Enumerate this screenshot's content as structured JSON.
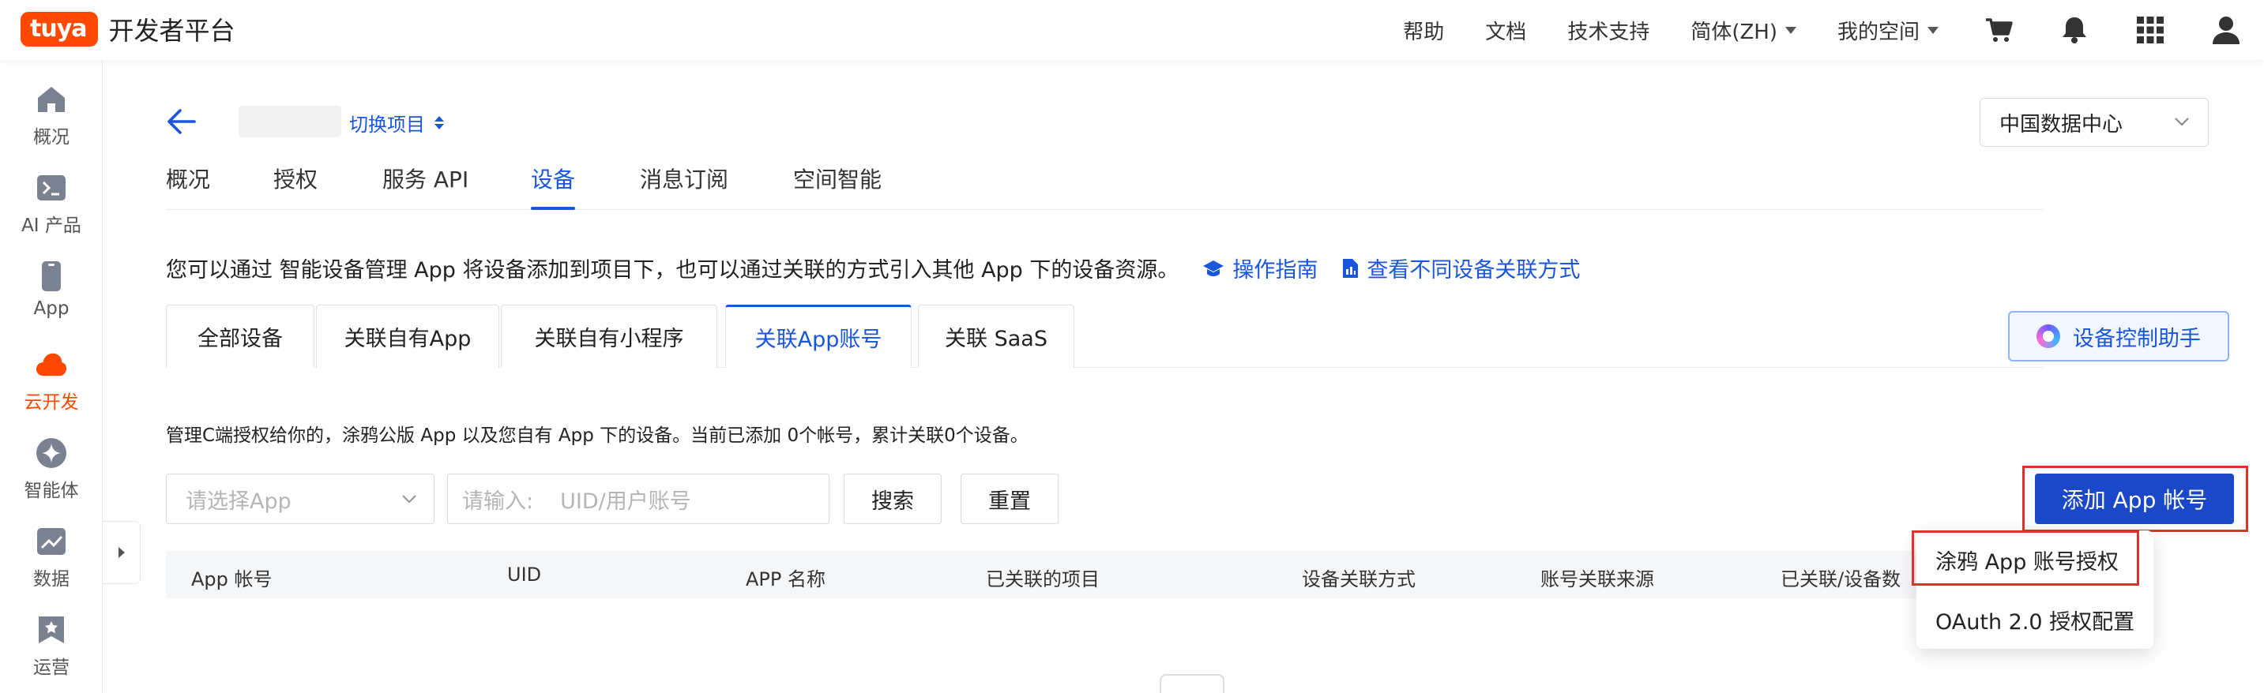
{
  "header": {
    "logo_badge": "tuya",
    "logo_text": "开发者平台",
    "nav": {
      "help": "帮助",
      "docs": "文档",
      "support": "技术支持",
      "language": "简体(ZH)",
      "my_space": "我的空间"
    }
  },
  "sidebar": {
    "items": [
      {
        "label": "概况",
        "icon": "home-icon"
      },
      {
        "label": "AI 产品",
        "icon": "terminal-icon"
      },
      {
        "label": "App",
        "icon": "phone-icon"
      },
      {
        "label": "云开发",
        "icon": "cloud-icon",
        "active": true
      },
      {
        "label": "智能体",
        "icon": "sparkle-icon"
      },
      {
        "label": "数据",
        "icon": "chart-icon"
      },
      {
        "label": "运营",
        "icon": "bookmark-icon"
      }
    ],
    "active_color": "#ff4800"
  },
  "project": {
    "switch_label": "切换项目"
  },
  "data_center": {
    "value": "中国数据中心"
  },
  "tabs": [
    "概况",
    "授权",
    "服务 API",
    "设备",
    "消息订阅",
    "空间智能"
  ],
  "intro": {
    "text": "您可以通过 智能设备管理 App 将设备添加到项目下，也可以通过关联的方式引入其他 App 下的设备资源。",
    "guide_link": "操作指南",
    "compare_link": "查看不同设备关联方式"
  },
  "subtabs": [
    "全部设备",
    "关联自有App",
    "关联自有小程序",
    "关联App账号",
    "关联 SaaS"
  ],
  "assistant_button": "设备控制助手",
  "description": "管理C端授权给你的，涂鸦公版 App 以及您自有 App 下的设备。当前已添加 0个帐号，累计关联0个设备。",
  "filters": {
    "app_select_placeholder": "请选择App",
    "input_prefix": "请输入:",
    "input_placeholder": "UID/用户账号",
    "search_button": "搜索",
    "reset_button": "重置"
  },
  "add_button": "添加 App 帐号",
  "table": {
    "columns": [
      "App 帐号",
      "UID",
      "APP 名称",
      "已关联的项目",
      "设备关联方式",
      "账号关联来源",
      "已关联/设备数"
    ]
  },
  "dropdown": {
    "items": [
      "涂鸦 App 账号授权",
      "OAuth 2.0 授权配置"
    ]
  },
  "colors": {
    "brand": "#ff4800",
    "primary": "#1a56db",
    "primary_button": "#1a48c9",
    "highlight": "#e0302a"
  }
}
